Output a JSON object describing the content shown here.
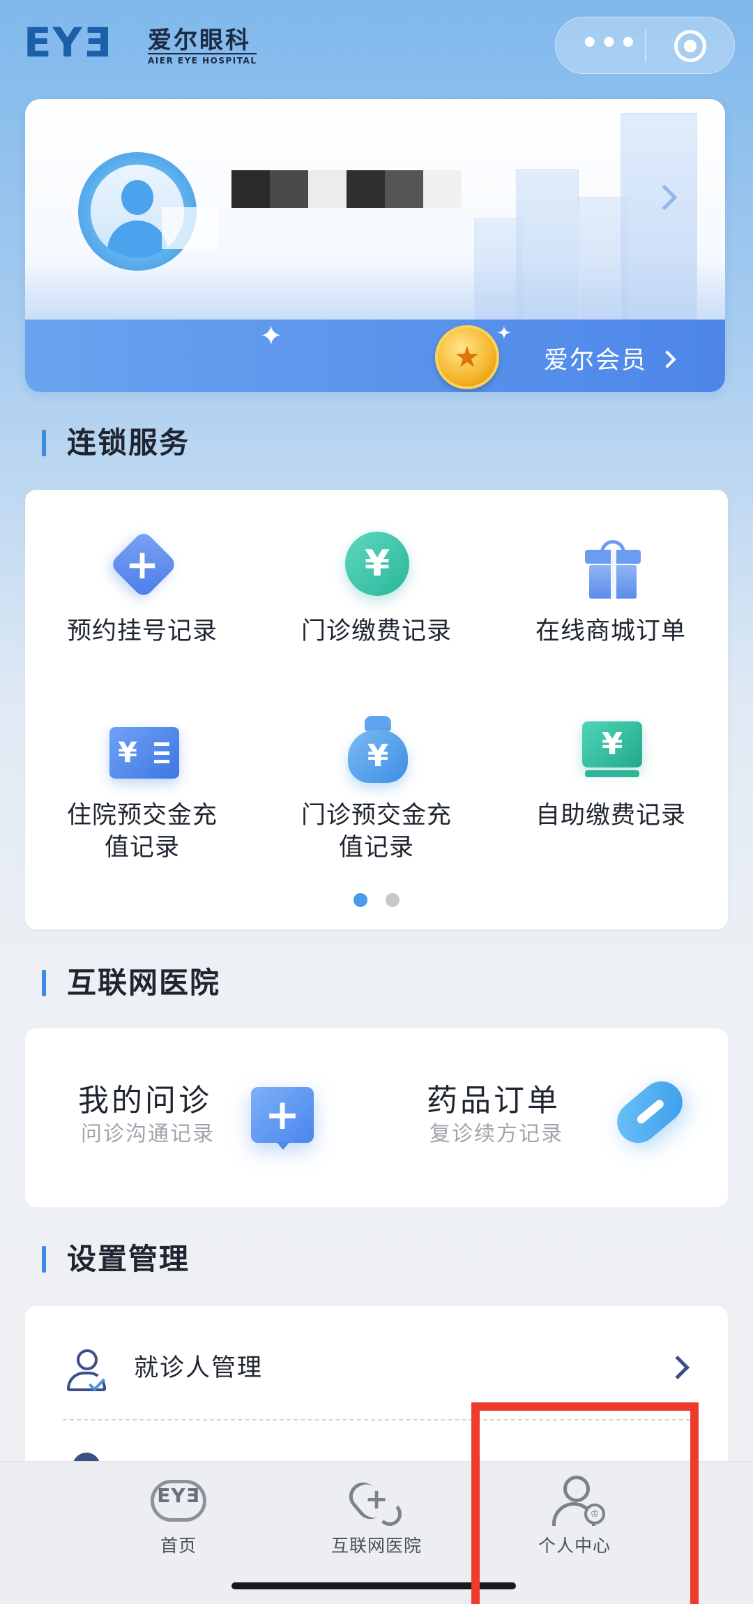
{
  "header": {
    "logo_mark": "EYƎ",
    "logo_cn": "爱尔眼科",
    "logo_en": "AIER EYE HOSPITAL",
    "capsule_more": "•••"
  },
  "profile": {
    "name_redacted": true,
    "member_label": "爱尔会员"
  },
  "chain_services": {
    "title": "连锁服务",
    "items": [
      {
        "label": "预约挂号记录",
        "icon": "appointment-icon"
      },
      {
        "label": "门诊缴费记录",
        "icon": "yuan-coin-icon"
      },
      {
        "label": "在线商城订单",
        "icon": "gift-icon"
      },
      {
        "label": "住院预交金充值记录",
        "icon": "yuan-card-icon"
      },
      {
        "label": "门诊预交金充值记录",
        "icon": "money-bag-icon"
      },
      {
        "label": "自助缴费记录",
        "icon": "yuan-screen-icon"
      }
    ],
    "pages": 2,
    "active_page": 1
  },
  "internet_hospital": {
    "title": "互联网医院",
    "items": [
      {
        "title": "我的问诊",
        "subtitle": "问诊沟通记录",
        "icon": "chat-plus-icon"
      },
      {
        "title": "药品订单",
        "subtitle": "复诊续方记录",
        "icon": "pill-icon"
      }
    ]
  },
  "settings": {
    "title": "设置管理",
    "items": [
      {
        "label": "就诊人管理",
        "icon": "patient-icon"
      }
    ]
  },
  "tabbar": {
    "tabs": [
      {
        "label": "首页",
        "icon": "home-logo-icon"
      },
      {
        "label": "互联网医院",
        "icon": "stethoscope-icon"
      },
      {
        "label": "个人中心",
        "icon": "user-center-icon"
      }
    ],
    "home_logo_text": "EYƎ"
  },
  "colors": {
    "accent": "#3b8be0",
    "member_bar": "#4d86e8",
    "highlight": "#ee3b2b"
  }
}
